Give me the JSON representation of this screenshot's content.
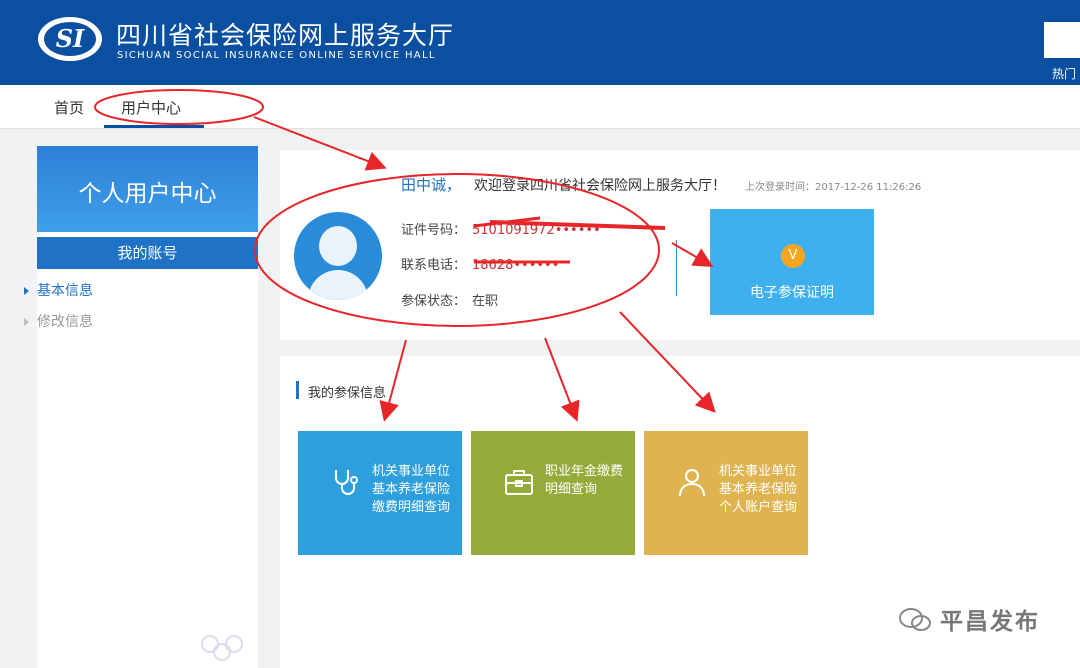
{
  "header": {
    "title_cn": "四川省社会保险网上服务大厅",
    "title_en": "SICHUAN SOCIAL INSURANCE ONLINE SERVICE HALL",
    "logo_text": "SI",
    "hot_label": "热门"
  },
  "nav": {
    "items": [
      {
        "label": "首页"
      },
      {
        "label": "用户中心"
      }
    ],
    "active": "用户中心"
  },
  "sidebar": {
    "heading": "个人用户中心",
    "tab": "我的账号",
    "links": [
      {
        "label": "基本信息",
        "active": true
      },
      {
        "label": "修改信息",
        "active": false
      }
    ]
  },
  "user": {
    "name": "田中诚，",
    "welcome": "欢迎登录四川省社会保险网上服务大厅！",
    "last_login": "上次登录时间：2017-12-26 11:26:26",
    "id_label": "证件号码：",
    "id_value": "5101091972••••••",
    "phone_label": "联系电话：",
    "phone_value": "18628••••••",
    "status_label": "参保状态：",
    "status_value": "在职"
  },
  "cert": {
    "icon": "v-badge-icon",
    "label": "电子参保证明"
  },
  "insurance": {
    "title": "我的参保信息",
    "tiles": [
      {
        "icon": "stethoscope-icon",
        "lines": [
          "机关事业单位",
          "基本养老保险",
          "缴费明细查询"
        ],
        "color": "#2c9fdc"
      },
      {
        "icon": "briefcase-icon",
        "lines": [
          "职业年金缴费",
          "明细查询"
        ],
        "color": "#94ab3a"
      },
      {
        "icon": "person-icon",
        "lines": [
          "机关事业单位",
          "基本养老保险",
          "个人账户查询"
        ],
        "color": "#dfb450"
      }
    ]
  },
  "watermark": "平昌发布",
  "colors": {
    "header_bg": "#0a4fa0",
    "accent": "#1f72c6",
    "annotation_red": "#e8262a"
  }
}
